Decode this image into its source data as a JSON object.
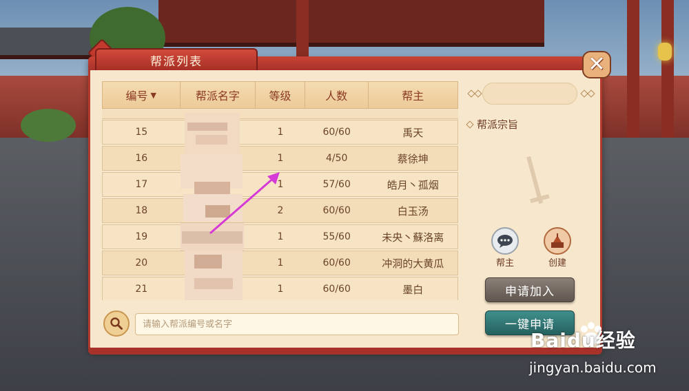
{
  "dialog": {
    "title": "帮派列表",
    "close_icon": "close-x-icon"
  },
  "table": {
    "headers": {
      "id": "编号",
      "id_sort_icon": "▼",
      "name": "帮派名字",
      "level": "等级",
      "members": "人数",
      "leader": "帮主"
    },
    "rows": [
      {
        "id": "15",
        "level": "1",
        "members": "60/60",
        "leader": "禹天"
      },
      {
        "id": "16",
        "level": "1",
        "members": "4/50",
        "leader": "蔡徐坤"
      },
      {
        "id": "17",
        "level": "1",
        "members": "57/60",
        "leader": "皓月丶孤烟"
      },
      {
        "id": "18",
        "level": "2",
        "members": "60/60",
        "leader": "白玉汤"
      },
      {
        "id": "19",
        "level": "1",
        "members": "55/60",
        "leader": "未央丶蘇洛离"
      },
      {
        "id": "20",
        "level": "1",
        "members": "60/60",
        "leader": "冲洞的大黄瓜"
      },
      {
        "id": "21",
        "level": "1",
        "members": "60/60",
        "leader": "墨白"
      }
    ]
  },
  "search": {
    "placeholder": "请输入帮派编号或名字",
    "icon": "magnifier-icon"
  },
  "side": {
    "purpose_label": "帮派宗旨",
    "leader_label": "帮主",
    "create_label": "创建",
    "apply_button": "申请加入",
    "quick_apply_button": "一键申请"
  },
  "watermark": {
    "logo": "Baidu经验",
    "url": "jingyan.baidu.com"
  },
  "colors": {
    "accent_red": "#b33a2c",
    "panel": "#f7e7cc",
    "annotation_arrow": "#d63ad6"
  }
}
